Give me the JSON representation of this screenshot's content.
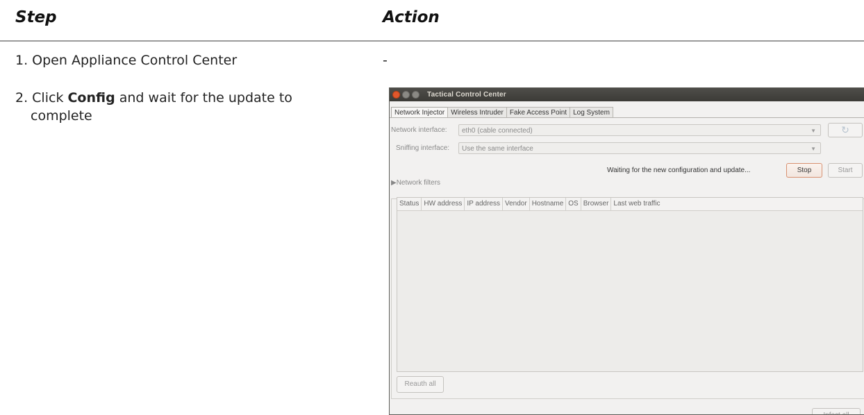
{
  "header": {
    "step": "Step",
    "action": "Action"
  },
  "rows": [
    {
      "step": "1. Open Appliance Control Center",
      "action": "-"
    },
    {
      "step_prefix": "2. Click ",
      "step_bold": "Config",
      "step_suffix": " and wait for the update to",
      "step_cont": "complete"
    }
  ],
  "window": {
    "title": "Tactical Control Center",
    "tabs": [
      "Network Injector",
      "Wireless Intruder",
      "Fake Access Point",
      "Log System"
    ],
    "network_interface_label": "Network interface:",
    "network_interface_value": "eth0 (cable connected)",
    "sniffing_interface_label": "Sniffing interface:",
    "sniffing_interface_value": "Use the same interface",
    "status_text": "Waiting for the new configuration and update...",
    "stop_label": "Stop",
    "start_label": "Start",
    "refresh_icon": "refresh-icon",
    "network_filters_label": "Network filters",
    "table_columns": [
      "Status",
      "HW address",
      "IP address",
      "Vendor",
      "Hostname",
      "OS",
      "Browser",
      "Last web traffic"
    ],
    "reauth_label": "Reauth all",
    "infect_label": "Infect all"
  }
}
